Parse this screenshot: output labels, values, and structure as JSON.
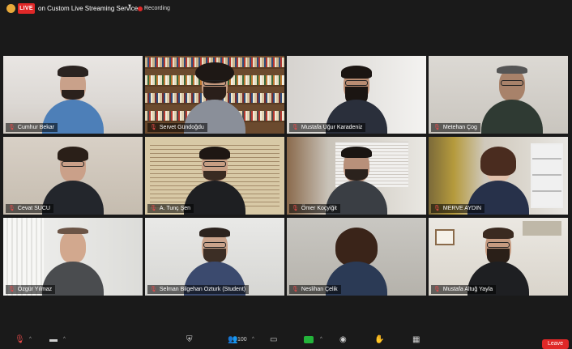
{
  "topbar": {
    "live_label": "LIVE",
    "service_label": "on Custom Live Streaming Service",
    "recording_label": "Recording"
  },
  "participants": [
    {
      "name": "Cumhur Bekar"
    },
    {
      "name": "Servet Gündoğdu"
    },
    {
      "name": "Mustafa Uğur Karadeniz"
    },
    {
      "name": "Metehan Çog"
    },
    {
      "name": "Cevat SUCU"
    },
    {
      "name": "A. Tunç Şen"
    },
    {
      "name": "Ömer Koçyiğit"
    },
    {
      "name": "MERVE AYDIN"
    },
    {
      "name": "Özgür Yılmaz"
    },
    {
      "name": "Selman Bilgehan Ozturk (Student)"
    },
    {
      "name": "Neslihan Çelik"
    },
    {
      "name": "Mustafa Altuğ Yayla"
    }
  ],
  "toolbar": {
    "participants_count": "100",
    "leave_label": "Leave"
  },
  "colors": {
    "live": "#e02828",
    "active_speaker": "#d5e54a",
    "share": "#23b33a",
    "leave": "#e02828"
  }
}
